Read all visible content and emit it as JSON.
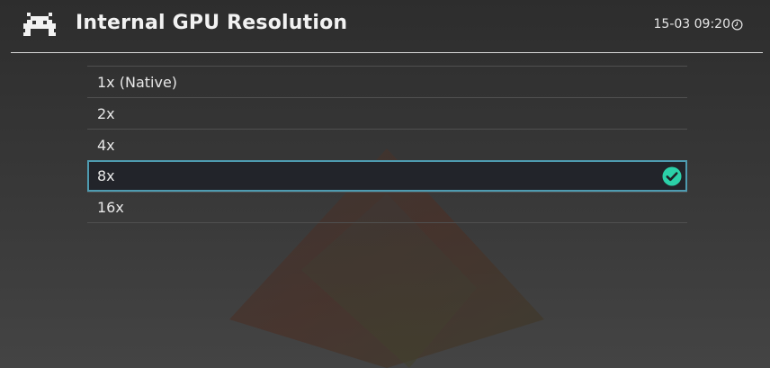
{
  "header": {
    "title": "Internal GPU Resolution",
    "time": "15-03 09:20",
    "logo_icon": "retroarch-invader-icon",
    "clock_icon": "clock-icon"
  },
  "options": [
    {
      "label": "1x (Native)",
      "selected": false
    },
    {
      "label": "2x",
      "selected": false
    },
    {
      "label": "4x",
      "selected": false
    },
    {
      "label": "8x",
      "selected": true
    },
    {
      "label": "16x",
      "selected": false
    }
  ],
  "colors": {
    "selection_border": "#4e9bb0",
    "check": "#2bd0a8"
  }
}
